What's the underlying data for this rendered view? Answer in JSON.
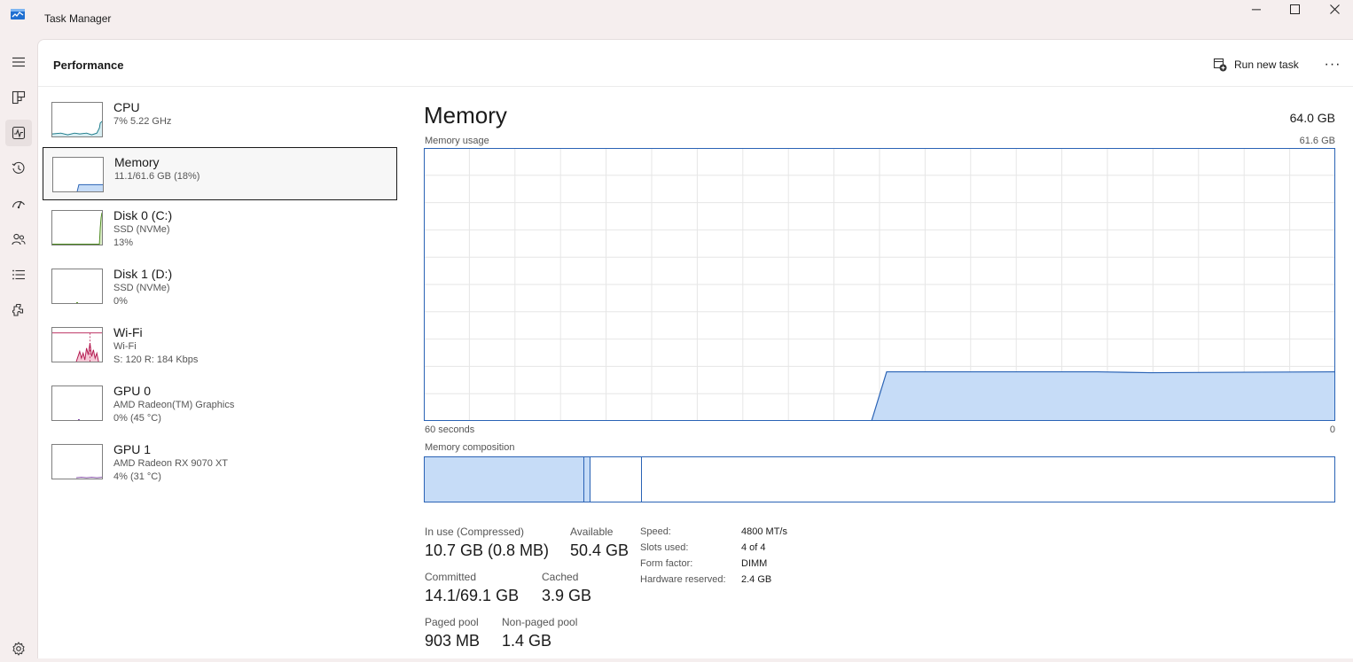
{
  "window": {
    "title": "Task Manager",
    "minimize": "─",
    "maximize": "☐",
    "close": "✕"
  },
  "rail": {
    "items": [
      {
        "name": "hamburger-menu-icon"
      },
      {
        "name": "processes-icon"
      },
      {
        "name": "performance-icon",
        "active": true
      },
      {
        "name": "app-history-icon"
      },
      {
        "name": "startup-apps-icon"
      },
      {
        "name": "users-icon"
      },
      {
        "name": "details-icon"
      },
      {
        "name": "services-icon"
      },
      {
        "name": "settings-icon"
      }
    ]
  },
  "header": {
    "title": "Performance",
    "run_new_task": "Run new task",
    "more": "···"
  },
  "devices": [
    {
      "id": "cpu",
      "name": "CPU",
      "line1": "7%  5.22 GHz",
      "line2": "",
      "color": "#1a7a8a",
      "fill": "#d8eef2",
      "selected": false
    },
    {
      "id": "memory",
      "name": "Memory",
      "line1": "11.1/61.6 GB (18%)",
      "line2": "",
      "color": "#2a63b5",
      "fill": "#c6dcf7",
      "selected": true
    },
    {
      "id": "disk0",
      "name": "Disk 0 (C:)",
      "line1": "SSD (NVMe)",
      "line2": "13%",
      "color": "#4c8a1e",
      "fill": "#dcedc8",
      "selected": false
    },
    {
      "id": "disk1",
      "name": "Disk 1 (D:)",
      "line1": "SSD (NVMe)",
      "line2": "0%",
      "color": "#4c8a1e",
      "fill": "#dcedc8",
      "selected": false
    },
    {
      "id": "wifi",
      "name": "Wi-Fi",
      "line1": "Wi-Fi",
      "line2": "S: 120  R: 184 Kbps",
      "color": "#b3184f",
      "fill": "#f5c8d6",
      "selected": false
    },
    {
      "id": "gpu0",
      "name": "GPU 0",
      "line1": "AMD Radeon(TM) Graphics",
      "line2": "0%  (45 °C)",
      "color": "#7a3fa0",
      "fill": "#e8d8f2",
      "selected": false
    },
    {
      "id": "gpu1",
      "name": "GPU 1",
      "line1": "AMD Radeon RX 9070 XT",
      "line2": "4%  (31 °C)",
      "color": "#7a3fa0",
      "fill": "#e8d8f2",
      "selected": false
    }
  ],
  "memory": {
    "title": "Memory",
    "total": "64.0 GB",
    "usage_label": "Memory usage",
    "usage_max": "61.6 GB",
    "time_left": "60 seconds",
    "time_right": "0",
    "composition_label": "Memory composition",
    "graph_fraction": 0.18,
    "stats": {
      "in_use_label": "In use (Compressed)",
      "in_use_value": "10.7 GB (0.8 MB)",
      "available_label": "Available",
      "available_value": "50.4 GB",
      "committed_label": "Committed",
      "committed_value": "14.1/69.1 GB",
      "cached_label": "Cached",
      "cached_value": "3.9 GB",
      "paged_label": "Paged pool",
      "paged_value": "903 MB",
      "nonpaged_label": "Non-paged pool",
      "nonpaged_value": "1.4 GB"
    },
    "specs": {
      "speed_label": "Speed:",
      "speed_value": "4800 MT/s",
      "slots_label": "Slots used:",
      "slots_value": "4 of 4",
      "form_label": "Form factor:",
      "form_value": "DIMM",
      "hw_label": "Hardware reserved:",
      "hw_value": "2.4 GB"
    }
  },
  "colors": {
    "accent": "#2a63b5",
    "accent_fill": "#c6dcf7",
    "grid": "#e6e6e6"
  }
}
